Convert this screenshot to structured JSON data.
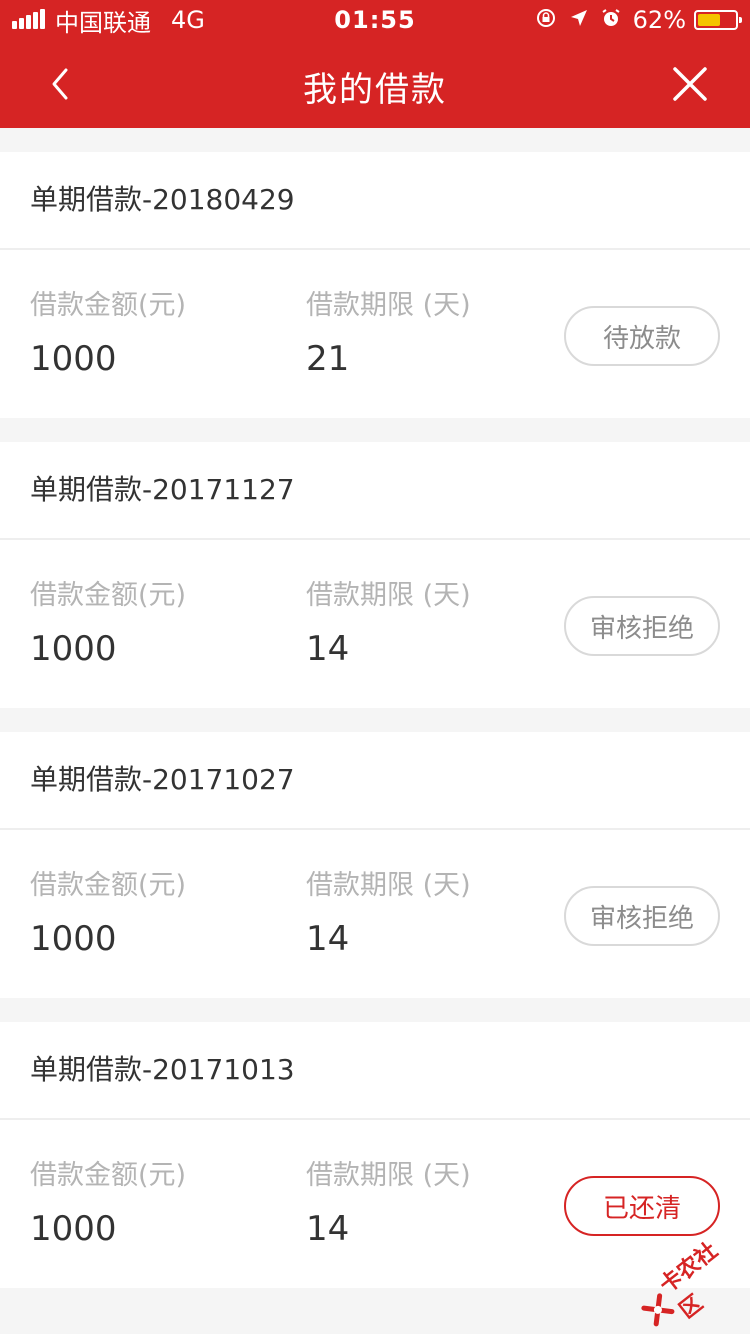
{
  "status_bar": {
    "carrier": "中国联通",
    "network": "4G",
    "time": "01:55",
    "battery_percent_text": "62%",
    "battery_level": 0.62,
    "battery_color": "#f5c400"
  },
  "nav": {
    "title": "我的借款",
    "back_icon": "chevron-left-icon",
    "close_icon": "close-icon",
    "brand_color": "#d62424"
  },
  "loans": [
    {
      "title": "单期借款-20180429",
      "amount_label": "借款金额(元)",
      "amount": "1000",
      "term_label": "借款期限 (天)",
      "term": "21",
      "status": "待放款",
      "status_type": "pending"
    },
    {
      "title": "单期借款-20171127",
      "amount_label": "借款金额(元)",
      "amount": "1000",
      "term_label": "借款期限 (天)",
      "term": "14",
      "status": "审核拒绝",
      "status_type": "rejected"
    },
    {
      "title": "单期借款-20171027",
      "amount_label": "借款金额(元)",
      "amount": "1000",
      "term_label": "借款期限 (天)",
      "term": "14",
      "status": "审核拒绝",
      "status_type": "rejected"
    },
    {
      "title": "单期借款-20171013",
      "amount_label": "借款金额(元)",
      "amount": "1000",
      "term_label": "借款期限 (天)",
      "term": "14",
      "status": "已还清",
      "status_type": "done"
    }
  ],
  "watermark": {
    "text": "卡农社区"
  }
}
